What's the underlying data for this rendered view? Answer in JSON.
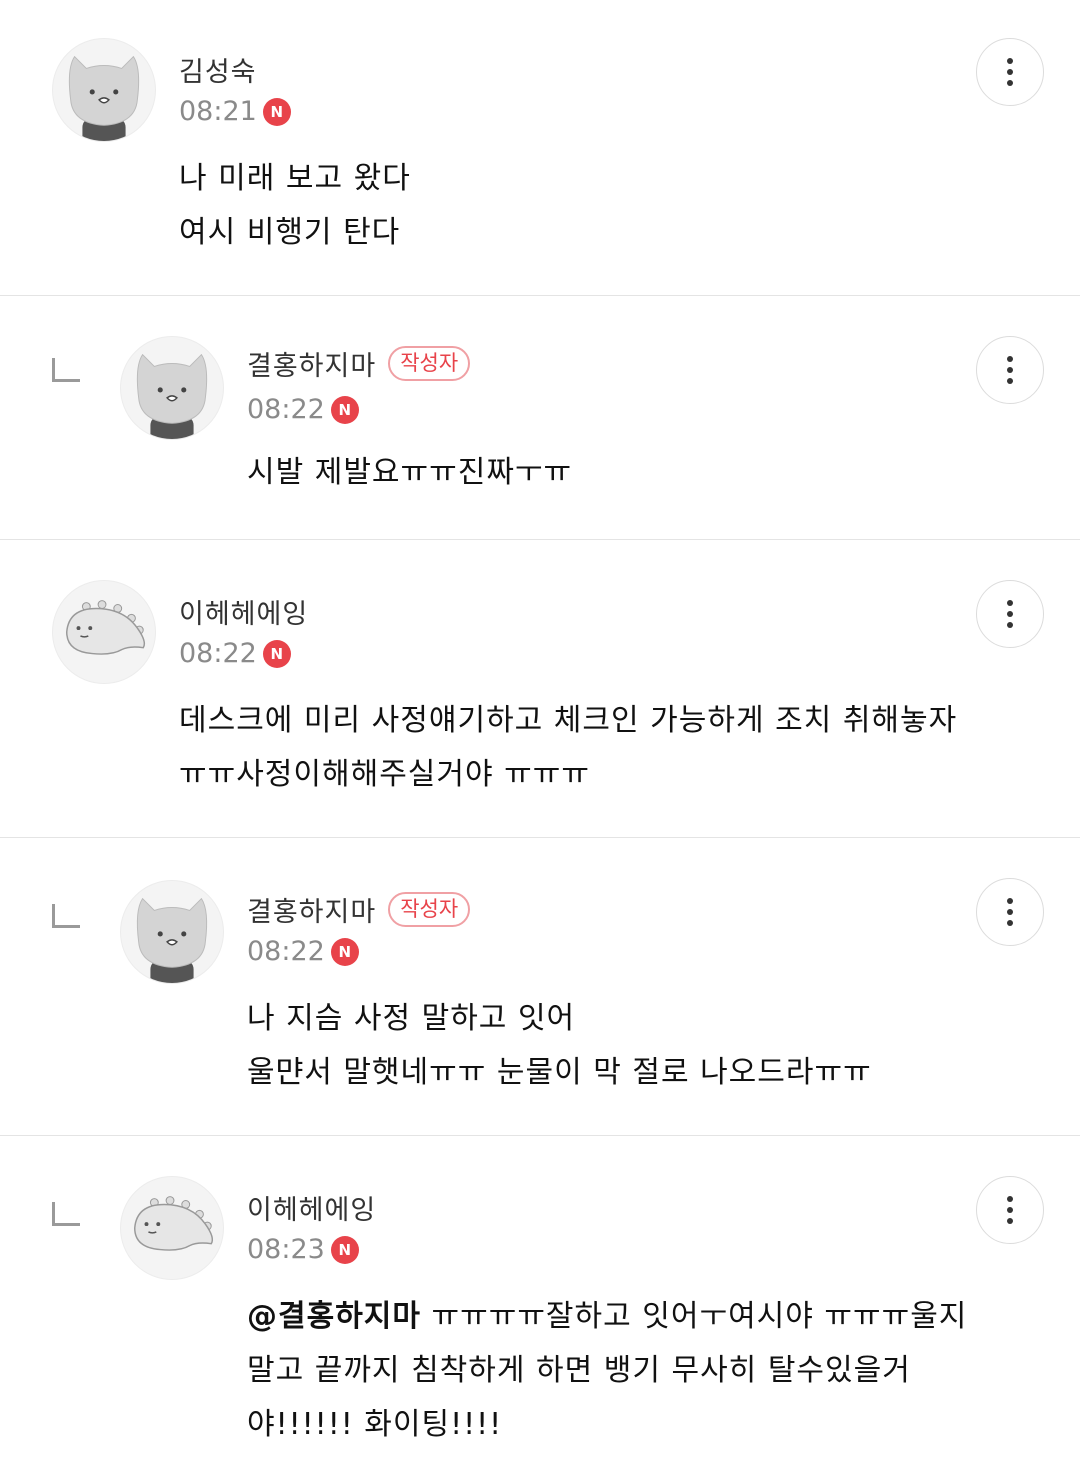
{
  "comments": [
    {
      "author": "김성숙",
      "is_writer": false,
      "time": "08:21",
      "new_badge": "N",
      "avatar": "cat-avatar-icon",
      "lines": [
        "나 미래 보고 왔다",
        "여시 비행기 탄다"
      ]
    },
    {
      "author": "결홍하지마",
      "is_writer": true,
      "writer_badge": "작성자",
      "time": "08:22",
      "new_badge": "N",
      "avatar": "cat-avatar-icon",
      "lines": [
        "시발 제발요ㅠㅠ진짜ㅜㅠ"
      ]
    },
    {
      "author": "이헤헤에잉",
      "is_writer": false,
      "time": "08:22",
      "new_badge": "N",
      "avatar": "dinosaur-avatar-icon",
      "lines": [
        "데스크에 미리 사정얘기하고 체크인 가능하게 조치 취해놓자",
        "ㅠㅠ사정이해해주실거야 ㅠㅠㅠ"
      ]
    },
    {
      "author": "결홍하지마",
      "is_writer": true,
      "writer_badge": "작성자",
      "time": "08:22",
      "new_badge": "N",
      "avatar": "cat-avatar-icon",
      "lines": [
        "나 지슴 사정 말하고 잇어",
        "울먄서 말햇네ㅠㅠ 눈물이 막 절로 나오드라ㅠㅠ"
      ]
    },
    {
      "author": "이헤헤에잉",
      "is_writer": false,
      "time": "08:23",
      "new_badge": "N",
      "avatar": "dinosaur-avatar-icon",
      "mention": "@결홍하지마",
      "line1_rest": " ㅠㅠㅠㅠ잘하고 잇어ㅜ여시야 ㅠㅠㅠ울지",
      "lines": [
        "말고 끝까지 침착하게 하면 뱅기 무사히 탈수있을거",
        "야!!!!!! 화이팅!!!!"
      ]
    }
  ],
  "more_icon": "more-vertical-icon",
  "reply_icon": "reply-arrow-icon",
  "colors": {
    "accent_red": "#e8434a",
    "divider": "#e4e4e4",
    "meta_gray": "#8a8a8a"
  }
}
